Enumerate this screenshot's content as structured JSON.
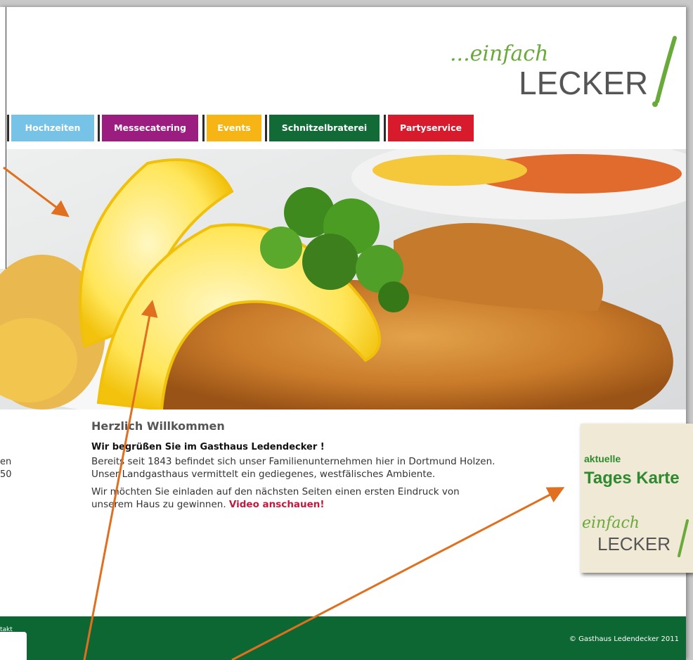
{
  "logo": {
    "script_text": "...einfach",
    "brand_text": "LECKER"
  },
  "nav": {
    "items": [
      {
        "label": "Hochzeiten",
        "color": "#77c3e8"
      },
      {
        "label": "Messecatering",
        "color": "#9b1d80"
      },
      {
        "label": "Events",
        "color": "#f7b515"
      },
      {
        "label": "Schnitzelbraterei",
        "color": "#126b37"
      },
      {
        "label": "Partyservice",
        "color": "#d71b2c"
      }
    ]
  },
  "welcome": {
    "title": "Herzlich Willkommen",
    "subtitle": "Wir begrüßen Sie im Gasthaus Ledendecker !",
    "paragraph1": "Bereits seit 1843 befindet sich unser Familienunternehmen hier in Dortmund Holzen. Unser Landgasthaus vermittelt ein gediegenes, westfälisches Ambiente.",
    "paragraph2": "Wir möchten Sie einladen auf den nächsten Seiten einen ersten Eindruck von unserem Haus zu gewinnen.",
    "video_link": "Video anschauen!"
  },
  "left_fragments": {
    "line1": "en",
    "line2": "50"
  },
  "tageskarte": {
    "label_small": "aktuelle",
    "label_big": "Tages Karte",
    "logo_script": "einfach",
    "logo_brand": "LECKER"
  },
  "footer": {
    "copyright": "© Gasthaus Ledendecker 2011",
    "left_fragment": "takt"
  },
  "colors": {
    "footer": "#0c6732",
    "arrow": "#e07020",
    "brand_green": "#6aaa3a"
  }
}
